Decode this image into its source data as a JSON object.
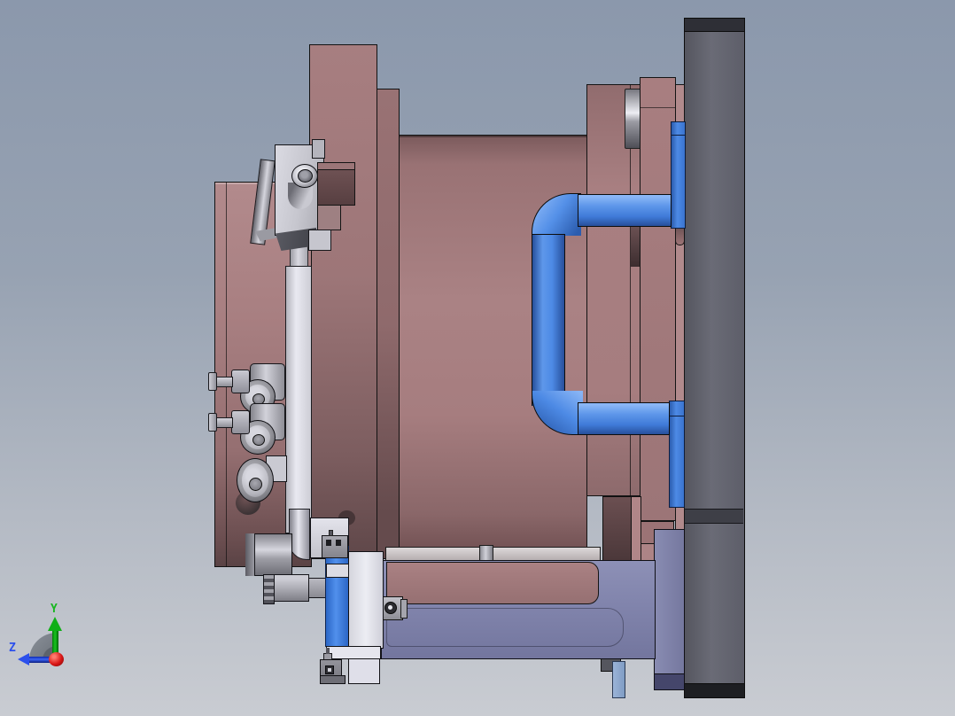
{
  "viewport": {
    "type": "3d-cad-view",
    "projection": "side-elevation",
    "background_top": "#8b98ac",
    "background_bottom": "#c9ccd2"
  },
  "triad": {
    "y_label": "Y",
    "z_label": "Z",
    "y_axis_color": "#17b71f",
    "z_axis_color": "#2c50ec",
    "origin_color": "#d81616"
  },
  "model": {
    "description": "mold clamping unit assembly side view",
    "parts": [
      {
        "name": "rear-platen",
        "color": "#64656f"
      },
      {
        "name": "mold-plates",
        "color": "#a87f81"
      },
      {
        "name": "core-cylinder",
        "color": "#a88082"
      },
      {
        "name": "cooling-pipes",
        "color": "#4d8ae5"
      },
      {
        "name": "pipe-fittings",
        "color": "#3a74cf"
      },
      {
        "name": "lower-housing",
        "color": "#8184ac"
      },
      {
        "name": "clamp-bracket",
        "color": "#c9c9d1"
      },
      {
        "name": "rollers",
        "color": "#b3b3bb"
      },
      {
        "name": "guide-bar",
        "color": "#e9e9f1"
      },
      {
        "name": "connector",
        "color": "#9a9aa2"
      }
    ]
  }
}
